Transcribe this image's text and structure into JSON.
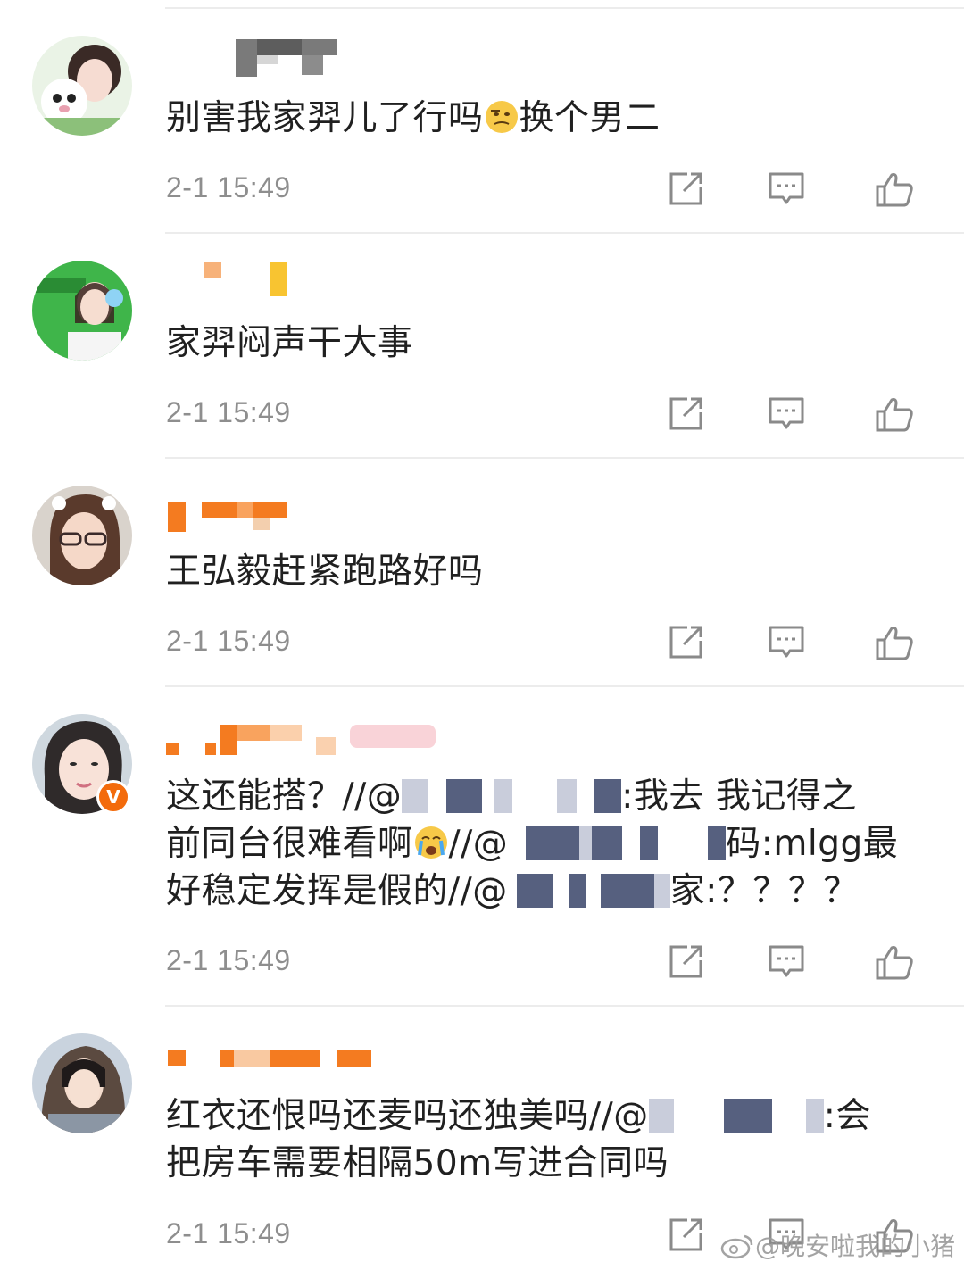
{
  "comments": [
    {
      "text_parts": [
        "别害我家羿儿了行吗",
        "换个男二"
      ],
      "time": "2-1 15:49",
      "emoji": "thinking-face-emoji"
    },
    {
      "text": "家羿闷声干大事",
      "time": "2-1 15:49"
    },
    {
      "text": "王弘毅赶紧跑路好吗",
      "time": "2-1 15:49"
    },
    {
      "line1_a": "这还能搭？//@",
      "line1_b": ":我去 我记得之",
      "line2_a": "前同台很难看啊",
      "line2_b": "//@",
      "line2_c": "码:mlgg最",
      "line3_a": "好稳定发挥是假的//@",
      "line3_b": "家:？？？？",
      "verified_badge": "V",
      "time": "2-1 15:49",
      "emoji": "crying-face-emoji"
    },
    {
      "line1_a": "红衣还恨吗还麦吗还独美吗//@",
      "line1_b": ":会",
      "line2": "把房车需要相隔50m写进合同吗",
      "time": "2-1 15:49"
    }
  ],
  "watermark": "@晚安啦我的小猪",
  "colors": {
    "redact": "#56607f",
    "mosaic_orange": "#f47b20",
    "text": "#202020",
    "time": "#8e8e8e"
  }
}
